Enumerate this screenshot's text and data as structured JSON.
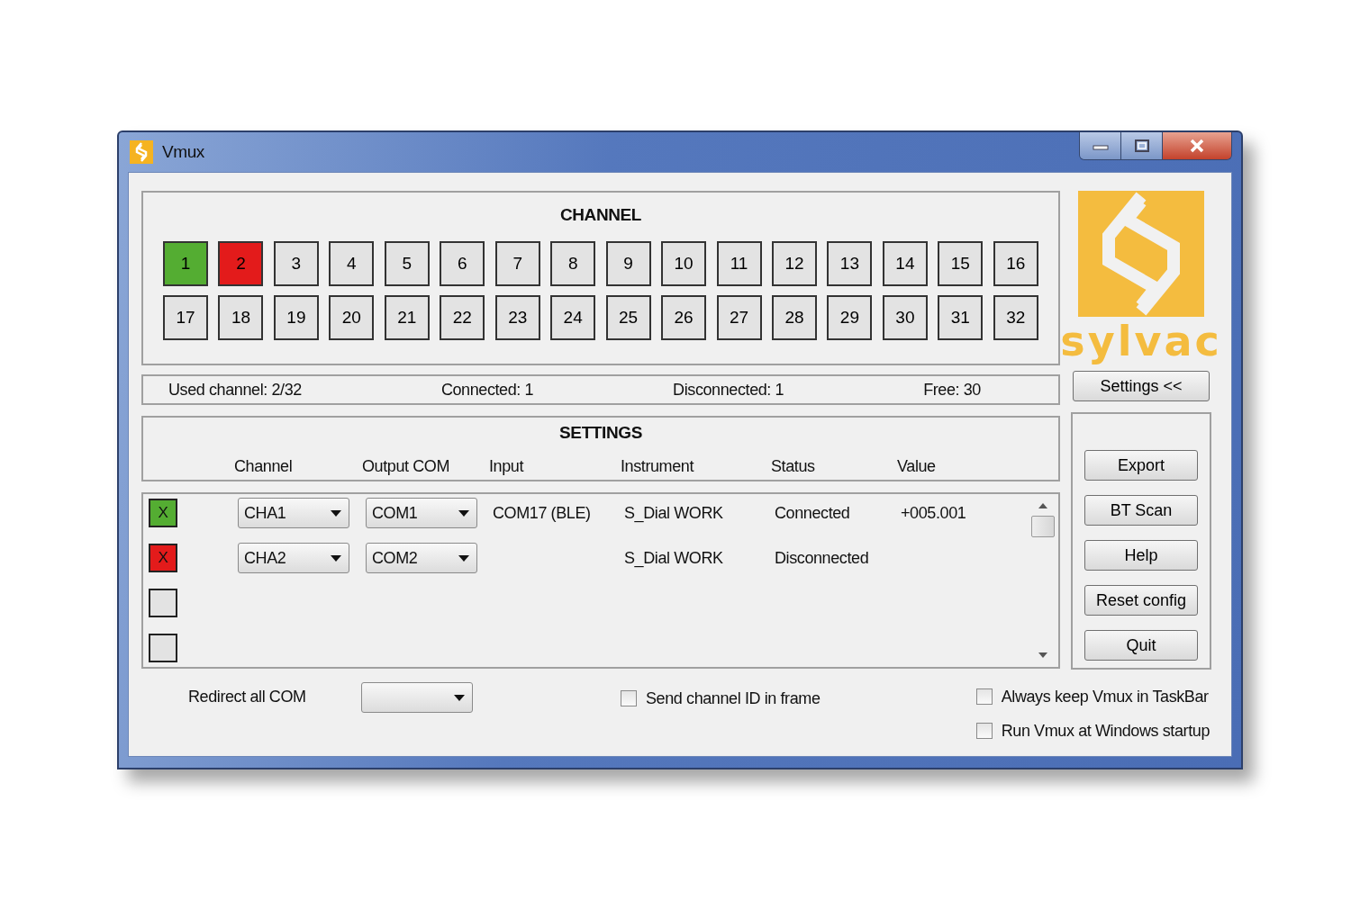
{
  "window": {
    "title": "Vmux"
  },
  "channel_panel": {
    "title": "CHANNEL",
    "channels": [
      {
        "label": "1",
        "color": "#54ad32"
      },
      {
        "label": "2",
        "color": "#e31b1b"
      },
      {
        "label": "3",
        "color": "#e3e3e3"
      },
      {
        "label": "4",
        "color": "#e3e3e3"
      },
      {
        "label": "5",
        "color": "#e3e3e3"
      },
      {
        "label": "6",
        "color": "#e3e3e3"
      },
      {
        "label": "7",
        "color": "#e3e3e3"
      },
      {
        "label": "8",
        "color": "#e3e3e3"
      },
      {
        "label": "9",
        "color": "#e3e3e3"
      },
      {
        "label": "10",
        "color": "#e3e3e3"
      },
      {
        "label": "11",
        "color": "#e3e3e3"
      },
      {
        "label": "12",
        "color": "#e3e3e3"
      },
      {
        "label": "13",
        "color": "#e3e3e3"
      },
      {
        "label": "14",
        "color": "#e3e3e3"
      },
      {
        "label": "15",
        "color": "#e3e3e3"
      },
      {
        "label": "16",
        "color": "#e3e3e3"
      },
      {
        "label": "17",
        "color": "#e3e3e3"
      },
      {
        "label": "18",
        "color": "#e3e3e3"
      },
      {
        "label": "19",
        "color": "#e3e3e3"
      },
      {
        "label": "20",
        "color": "#e3e3e3"
      },
      {
        "label": "21",
        "color": "#e3e3e3"
      },
      {
        "label": "22",
        "color": "#e3e3e3"
      },
      {
        "label": "23",
        "color": "#e3e3e3"
      },
      {
        "label": "24",
        "color": "#e3e3e3"
      },
      {
        "label": "25",
        "color": "#e3e3e3"
      },
      {
        "label": "26",
        "color": "#e3e3e3"
      },
      {
        "label": "27",
        "color": "#e3e3e3"
      },
      {
        "label": "28",
        "color": "#e3e3e3"
      },
      {
        "label": "29",
        "color": "#e3e3e3"
      },
      {
        "label": "30",
        "color": "#e3e3e3"
      },
      {
        "label": "31",
        "color": "#e3e3e3"
      },
      {
        "label": "32",
        "color": "#e3e3e3"
      }
    ]
  },
  "summary": [
    "Used channel: 2/32",
    "Connected: 1",
    "Disconnected: 1",
    "Free: 30"
  ],
  "logo": {
    "text": "sylvac"
  },
  "settings_toggle": "Settings <<",
  "settings": {
    "title": "SETTINGS",
    "columns": [
      "Channel",
      "Output COM",
      "Input",
      "Instrument",
      "Status",
      "Value"
    ],
    "rows": [
      {
        "color": "#54ad32",
        "mark": "X",
        "channel": "CHA1",
        "output_com": "COM1",
        "input": "COM17 (BLE)",
        "instrument": "S_Dial WORK",
        "state": "Connected",
        "value": "+005.001"
      },
      {
        "color": "#e31b1b",
        "mark": "X",
        "channel": "CHA2",
        "output_com": "COM2",
        "instrument": "S_Dial WORK",
        "state": "Disconnected"
      },
      {
        "color": "#e3e3e3"
      },
      {
        "color": "#e3e3e3"
      }
    ]
  },
  "buttons": [
    "Export",
    "BT Scan",
    "Help",
    "Reset config",
    "Quit"
  ],
  "redirect": {
    "label": "Redirect all COM"
  },
  "options": [
    {
      "label": "Send channel ID in frame",
      "checked": false
    },
    {
      "label": "Always keep Vmux in TaskBar",
      "checked": false
    },
    {
      "label": "Run Vmux at Windows startup",
      "checked": false
    }
  ]
}
